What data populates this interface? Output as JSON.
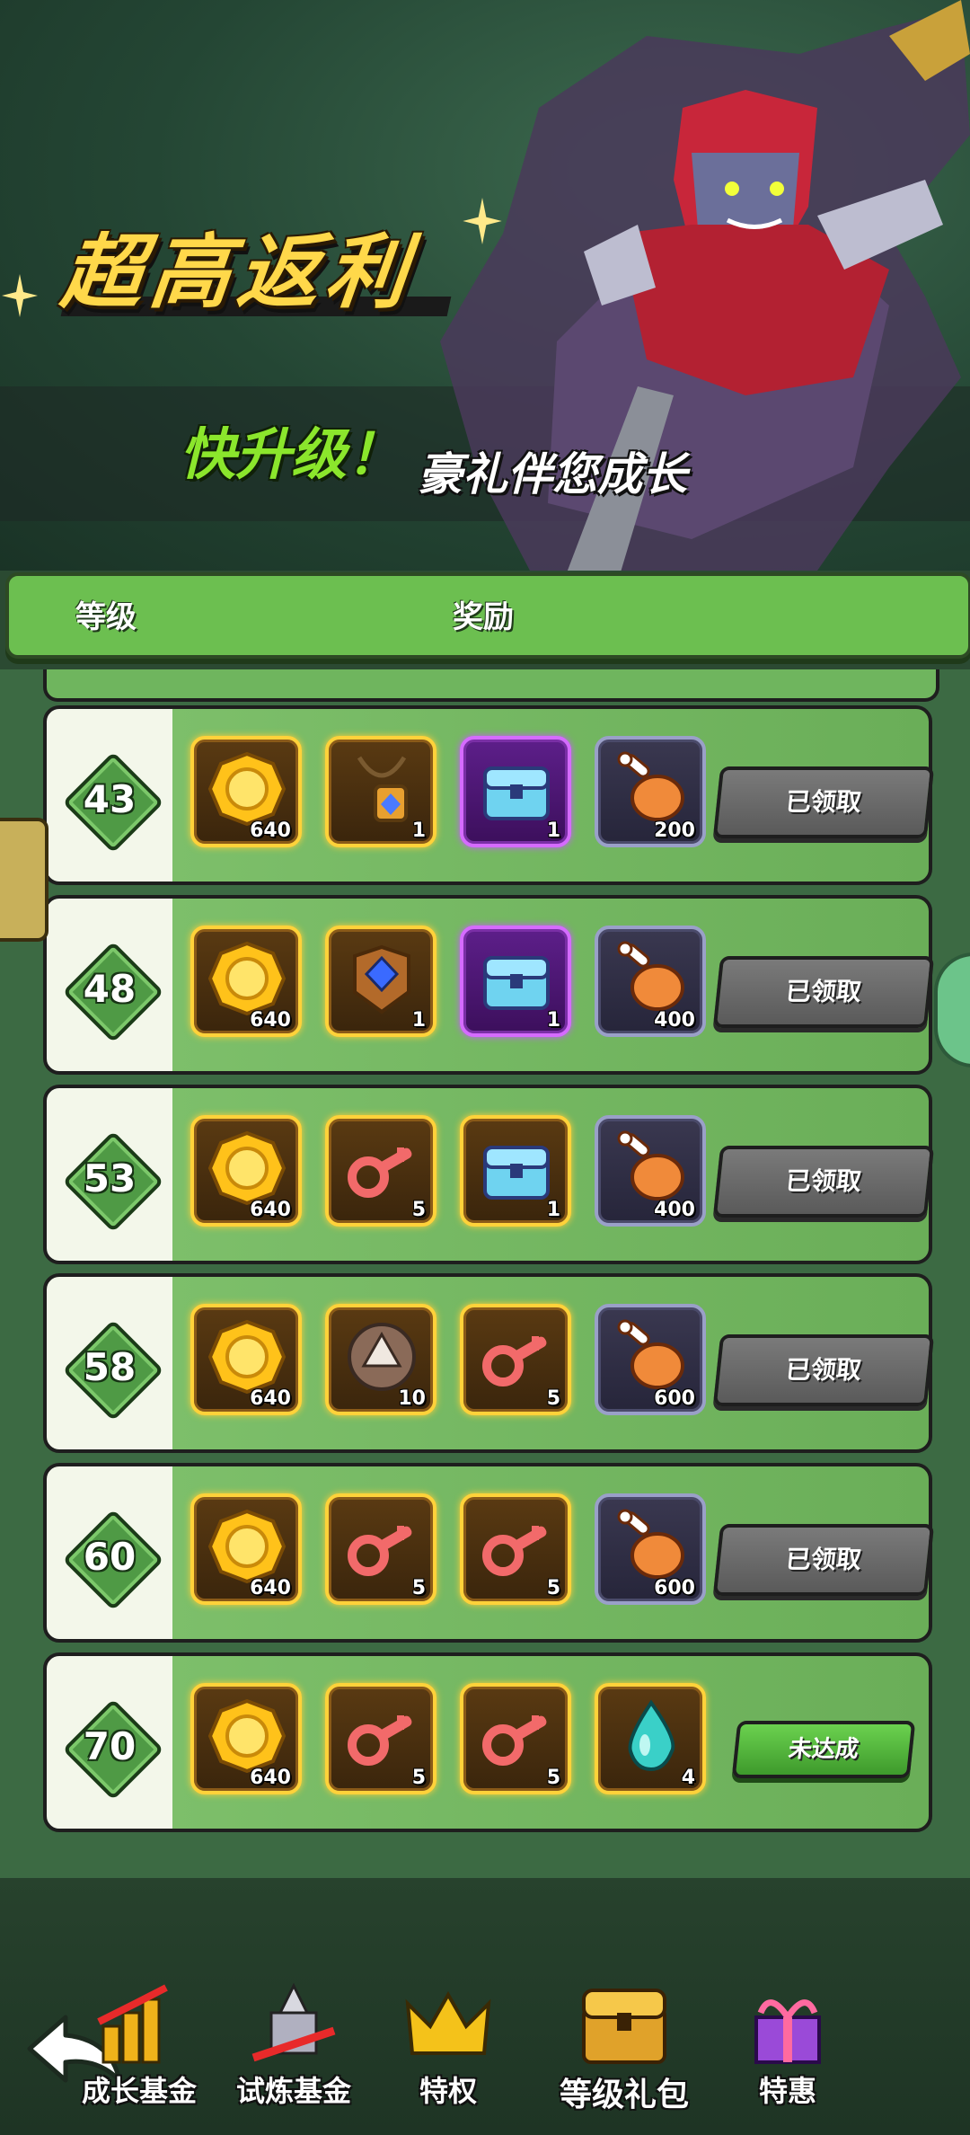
{
  "banner": {
    "title": "超高返利",
    "subtitle_green": "快升级！",
    "subtitle_white": "豪礼伴您成长"
  },
  "table_header": {
    "level": "等级",
    "reward": "奖励"
  },
  "rows": [
    {
      "level": "43",
      "items": [
        {
          "icon": "gold-coin-icon",
          "frame": "gold",
          "qty": "640"
        },
        {
          "icon": "amulet-icon",
          "frame": "gold",
          "qty": "1"
        },
        {
          "icon": "chest-icon",
          "frame": "purple",
          "qty": "1"
        },
        {
          "icon": "drumstick-icon",
          "frame": "dark",
          "qty": "200"
        }
      ],
      "status": "已领取"
    },
    {
      "level": "48",
      "items": [
        {
          "icon": "gold-coin-icon",
          "frame": "gold",
          "qty": "640"
        },
        {
          "icon": "armor-icon",
          "frame": "gold",
          "qty": "1"
        },
        {
          "icon": "chest-icon",
          "frame": "purple",
          "qty": "1"
        },
        {
          "icon": "drumstick-icon",
          "frame": "dark",
          "qty": "400"
        }
      ],
      "status": "已领取"
    },
    {
      "level": "53",
      "items": [
        {
          "icon": "gold-coin-icon",
          "frame": "gold",
          "qty": "640"
        },
        {
          "icon": "key-icon",
          "frame": "gold",
          "qty": "5"
        },
        {
          "icon": "chest-icon",
          "frame": "gold",
          "qty": "1"
        },
        {
          "icon": "drumstick-icon",
          "frame": "dark",
          "qty": "400"
        }
      ],
      "status": "已领取"
    },
    {
      "level": "58",
      "items": [
        {
          "icon": "gold-coin-icon",
          "frame": "gold",
          "qty": "640"
        },
        {
          "icon": "claw-orb-icon",
          "frame": "gold",
          "qty": "10"
        },
        {
          "icon": "key-icon",
          "frame": "gold",
          "qty": "5"
        },
        {
          "icon": "drumstick-icon",
          "frame": "dark",
          "qty": "600"
        }
      ],
      "status": "已领取"
    },
    {
      "level": "60",
      "items": [
        {
          "icon": "gold-coin-icon",
          "frame": "gold",
          "qty": "640"
        },
        {
          "icon": "key-icon",
          "frame": "gold",
          "qty": "5"
        },
        {
          "icon": "key-icon",
          "frame": "gold",
          "qty": "5"
        },
        {
          "icon": "drumstick-icon",
          "frame": "dark",
          "qty": "600"
        }
      ],
      "status": "已领取"
    },
    {
      "level": "70",
      "items": [
        {
          "icon": "gold-coin-icon",
          "frame": "gold",
          "qty": "640"
        },
        {
          "icon": "key-icon",
          "frame": "gold",
          "qty": "5"
        },
        {
          "icon": "key-icon",
          "frame": "gold",
          "qty": "5"
        },
        {
          "icon": "water-drop-icon",
          "frame": "gold",
          "qty": "4"
        }
      ],
      "status": "未达成"
    }
  ],
  "nav": {
    "back_icon": "back-arrow-icon",
    "tabs": [
      {
        "label": "成长基金",
        "icon": "growth-fund-icon"
      },
      {
        "label": "试炼基金",
        "icon": "trial-fund-icon"
      },
      {
        "label": "特权",
        "icon": "crown-icon"
      },
      {
        "label": "等级礼包",
        "icon": "treasure-chest-icon",
        "active": true
      },
      {
        "label": "特惠",
        "icon": "gift-box-icon"
      }
    ]
  },
  "colors": {
    "accent_green": "#6cbf50",
    "title_yellow": "#ffd84a",
    "subtitle_green": "#8be62c",
    "claimed_gray": "#6a6a6a"
  }
}
